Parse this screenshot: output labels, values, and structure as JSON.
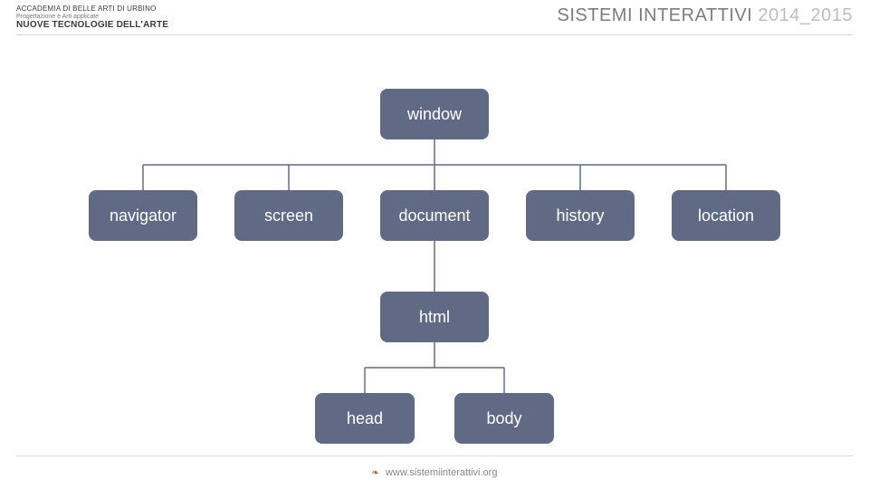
{
  "header": {
    "academy": "ACCADEMIA DI BELLE ARTI DI URBINO",
    "subtitle": "Progettazione e Arti applicate",
    "program": "NUOVE TECNOLOGIE DELL'ARTE",
    "course": "SISTEMI INTERATTIVI",
    "year": "2014_2015"
  },
  "footer": {
    "url": "www.sistemiinterattivi.org"
  },
  "nodes": {
    "window": "window",
    "navigator": "navigator",
    "screen": "screen",
    "document": "document",
    "history": "history",
    "location": "location",
    "html": "html",
    "head": "head",
    "body": "body"
  },
  "chart_data": {
    "type": "tree",
    "title": "Browser Object Model hierarchy",
    "root": "window",
    "edges": [
      [
        "window",
        "navigator"
      ],
      [
        "window",
        "screen"
      ],
      [
        "window",
        "document"
      ],
      [
        "window",
        "history"
      ],
      [
        "window",
        "location"
      ],
      [
        "document",
        "html"
      ],
      [
        "html",
        "head"
      ],
      [
        "html",
        "body"
      ]
    ],
    "colors": {
      "node_fill": "#606a84",
      "node_text": "#ffffff"
    }
  }
}
